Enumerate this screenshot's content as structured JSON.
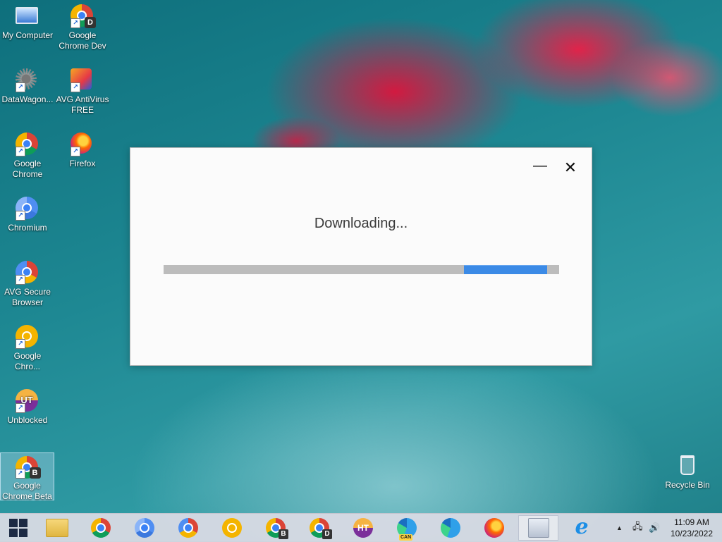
{
  "desktop": {
    "icons": [
      {
        "label": "My Computer"
      },
      {
        "label": "Google Chrome Dev",
        "badge": "D"
      },
      {
        "label": "DataWagon..."
      },
      {
        "label": "AVG AntiVirus FREE"
      },
      {
        "label": "Google Chrome"
      },
      {
        "label": "Firefox"
      },
      {
        "label": "Chromium"
      },
      {
        "label": "AVG Secure Browser"
      },
      {
        "label": "Google Chro..."
      },
      {
        "label": "Unblocked",
        "glyph_text": "UT"
      },
      {
        "label": "Google Chrome Beta",
        "badge": "B"
      },
      {
        "label": "Recycle Bin"
      }
    ]
  },
  "dialog": {
    "minimize_glyph": "—",
    "close_glyph": "✕",
    "title": "Downloading...",
    "progress": {
      "indeterminate": true,
      "segment_start_fraction": 0.76,
      "segment_end_fraction": 0.97
    }
  },
  "taskbar": {
    "items": [
      {
        "name": "start",
        "icon": "windows-logo-icon"
      },
      {
        "name": "file-explorer",
        "icon": "folder-icon"
      },
      {
        "name": "google-chrome",
        "icon": "chrome-icon"
      },
      {
        "name": "chromium",
        "icon": "chromium-icon"
      },
      {
        "name": "avg-secure-browser",
        "icon": "avg-browser-icon"
      },
      {
        "name": "chrome-canary-yellow",
        "icon": "chrome-yellow-icon"
      },
      {
        "name": "chrome-beta",
        "icon": "chrome-beta-icon",
        "badge": "B"
      },
      {
        "name": "chrome-dev",
        "icon": "chrome-dev-icon",
        "badge": "D"
      },
      {
        "name": "unblocked",
        "icon": "unblocked-icon",
        "text": "HT"
      },
      {
        "name": "edge-canary",
        "icon": "edge-canary-icon",
        "badge_text": "CAN"
      },
      {
        "name": "edge",
        "icon": "edge-icon"
      },
      {
        "name": "firefox",
        "icon": "firefox-icon"
      },
      {
        "name": "installer",
        "icon": "installer-disc-icon"
      },
      {
        "name": "internet-explorer",
        "icon": "internet-explorer-icon",
        "glyph": "e"
      }
    ],
    "tray": {
      "chevron": "▲",
      "network_glyph": "🖧",
      "volume_glyph": "🔊"
    },
    "clock": {
      "time": "11:09 AM",
      "date": "10/23/2022"
    }
  }
}
